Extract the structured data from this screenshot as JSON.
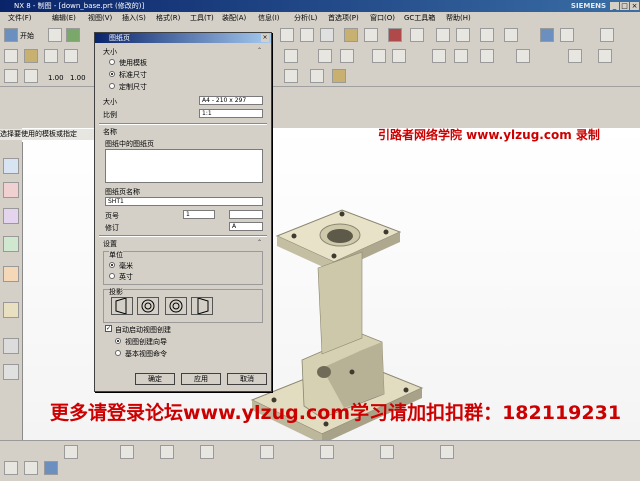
{
  "window": {
    "title": "NX 8 - 制图 - [down_base.prt (修改的)]",
    "brand": "SIEMENS"
  },
  "menubar": {
    "items": [
      "文件(F)",
      "编辑(E)",
      "视图(V)",
      "插入(S)",
      "格式(R)",
      "工具(T)",
      "装配(A)",
      "信息(I)",
      "分析(L)",
      "首选项(P)",
      "窗口(O)",
      "GC工具箱",
      "帮助(H)"
    ]
  },
  "toolbar": {
    "start_label": "开始",
    "scale_a": "1.00",
    "scale_b": "1.00"
  },
  "prompt": {
    "text": "选择要使用的模板或指定"
  },
  "dialog": {
    "title": "图纸页",
    "size_section": "大小",
    "size_options": [
      "使用模板",
      "标准尺寸",
      "定制尺寸"
    ],
    "size_selected_index": 1,
    "size_label": "大小",
    "size_value": "A4 - 210 x 297",
    "scale_label": "比例",
    "scale_value": "1:1",
    "name_section": "名称",
    "sheets_label": "图纸中的图纸页",
    "sheet_name_label": "图纸页名称",
    "sheet_name_value": "SHT1",
    "page_label": "页号",
    "page_value": "1",
    "revision_label": "修订",
    "revision_value": "A",
    "settings_section": "设置",
    "units_label": "单位",
    "units_options": [
      "毫米",
      "英寸"
    ],
    "units_selected_index": 0,
    "projection_label": "投影",
    "auto_view_label": "自动启动视图创建",
    "auto_view_checked": true,
    "view_options": [
      "视图创建向导",
      "基本视图命令"
    ],
    "view_selected_index": 0,
    "ok_label": "确定",
    "apply_label": "应用",
    "cancel_label": "取消"
  },
  "watermark": {
    "top": "引路者网络学院 www.ylzug.com 录制",
    "bottom": "更多请登录论坛www.ylzug.com学习请加扣扣群：182119231"
  },
  "colors": {
    "watermark": "#cc0000",
    "titlebar_start": "#0a246a",
    "part_body": "#e8e3c8"
  }
}
